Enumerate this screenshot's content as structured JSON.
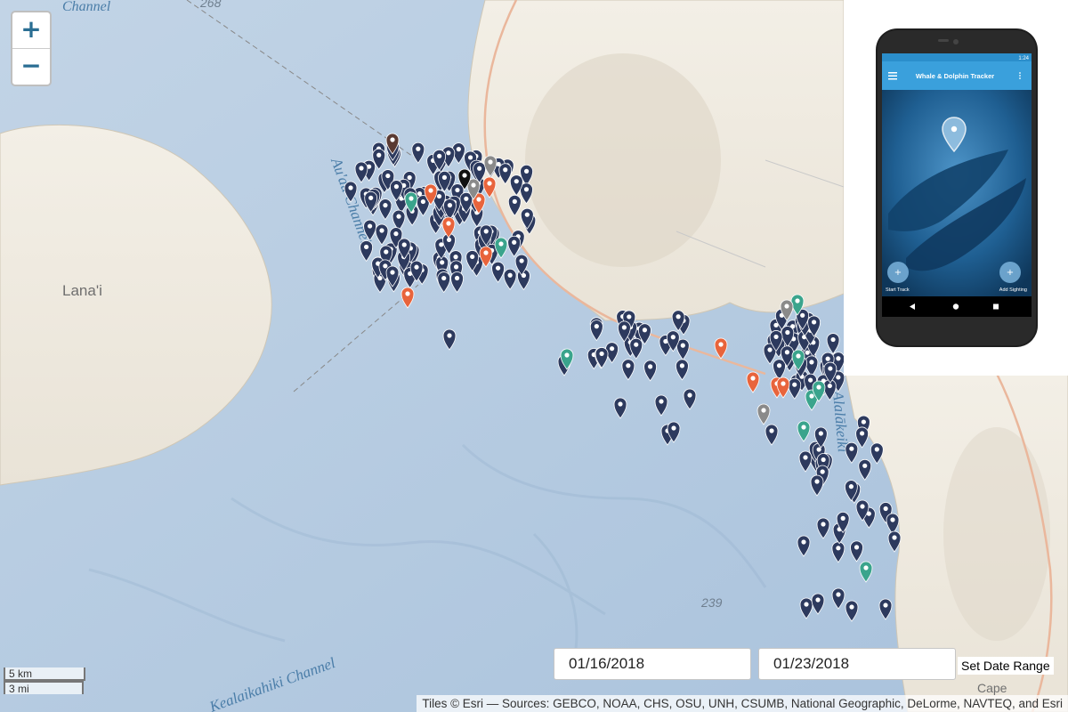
{
  "map": {
    "labels": {
      "island": "Lana'i",
      "channel_top": "Channel",
      "channel_main": "Au'au Channel",
      "channel_bottom": "Kealaikahiki Channel",
      "channel_right": "Alalākeiki",
      "num_top": "268",
      "num_bottom": "239",
      "cape": "Cape"
    },
    "zoom_in": "+",
    "zoom_out": "−",
    "scale": {
      "km": "5 km",
      "mi": "3 mi"
    },
    "attribution": "Tiles © Esri — Sources: GEBCO, NOAA, CHS, OSU, UNH, CSUMB, National Geographic, DeLorme, NAVTEQ, and Esri",
    "marker_colors": {
      "whale": "#2d3a5e",
      "dolphin": "#e8643c",
      "turtle": "#3aa48c",
      "other": "#8a8a8a",
      "seal": "#5a3a32",
      "unknown": "#111111"
    }
  },
  "date_range": {
    "start": "01/16/2018",
    "end": "01/23/2018",
    "button": "Set Date Range"
  },
  "phone": {
    "status_time": "1:24",
    "app_title": "Whale & Dolphin Tracker",
    "start_track": "Start Track",
    "add_sighting": "Add Sighting"
  }
}
